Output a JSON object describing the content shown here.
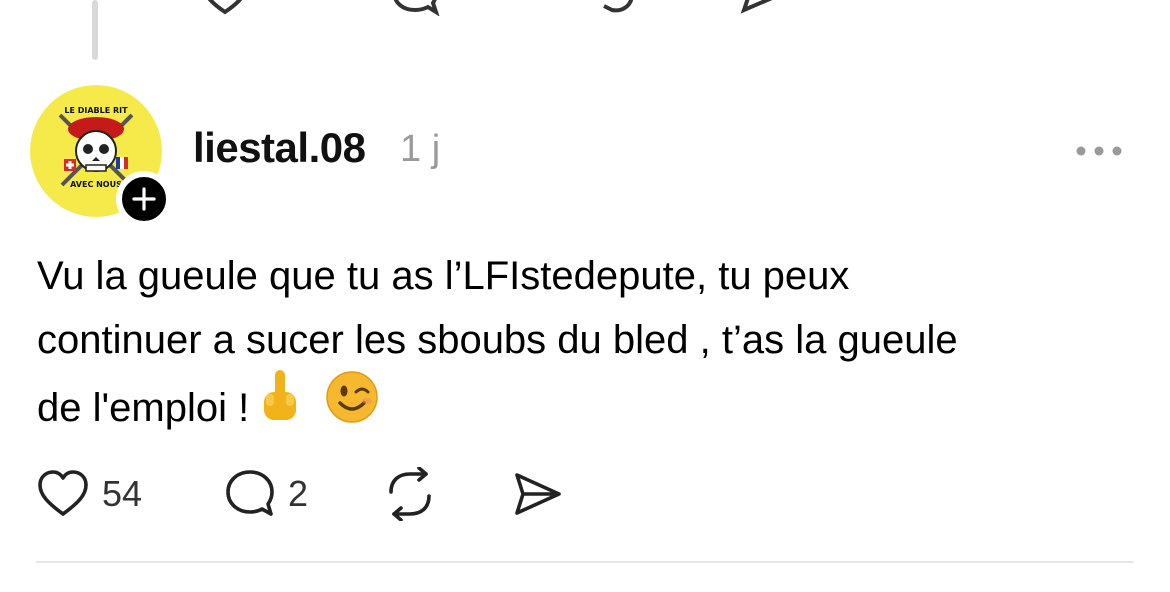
{
  "post": {
    "username": "liestal.08",
    "timestamp": "1 j",
    "text_lines": [
      "Vu la gueule que tu as l’LFIstedepute, tu peux",
      "continuer a sucer les sboubs du bled , t’as la gueule",
      "de l'emploi ! "
    ],
    "emojis": [
      "middle-finger-emoji",
      "winking-face-emoji"
    ],
    "avatar": {
      "badge_text_top": "LE DIABLE RIT",
      "badge_text_bottom": "AVEC NOUS",
      "background": "#f5ea4a"
    },
    "likes": "54",
    "replies": "2"
  },
  "icons": {
    "like": "heart-icon",
    "reply": "comment-icon",
    "repost": "repost-icon",
    "share": "send-icon",
    "more": "more-icon",
    "follow": "plus-icon"
  },
  "colors": {
    "text": "#000000",
    "muted": "#9a9a9a",
    "divider": "#e6e6e6",
    "thread_line": "#d9d9d9"
  }
}
